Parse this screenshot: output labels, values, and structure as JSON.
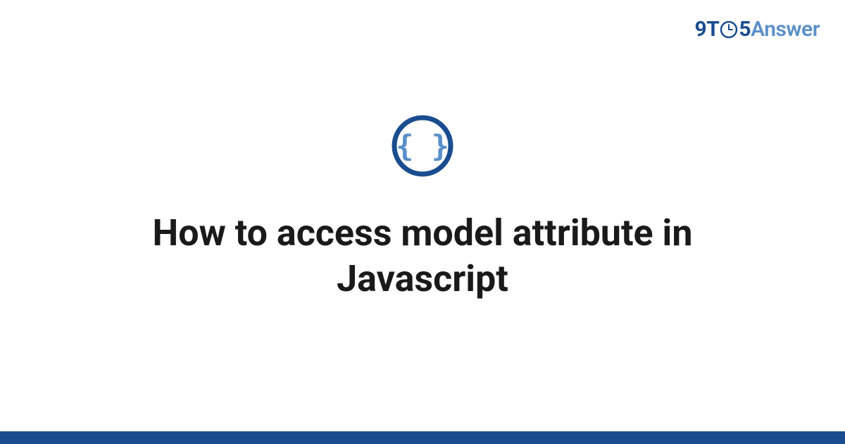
{
  "brand": {
    "part1": "9T",
    "part2": "5",
    "part3": "Answer"
  },
  "topic": {
    "icon_name": "curly-braces-icon"
  },
  "title": "How to access model attribute in Javascript",
  "colors": {
    "dark_blue": "#1a4d8f",
    "light_blue": "#5a8fc9",
    "text": "#1a1a1a"
  }
}
